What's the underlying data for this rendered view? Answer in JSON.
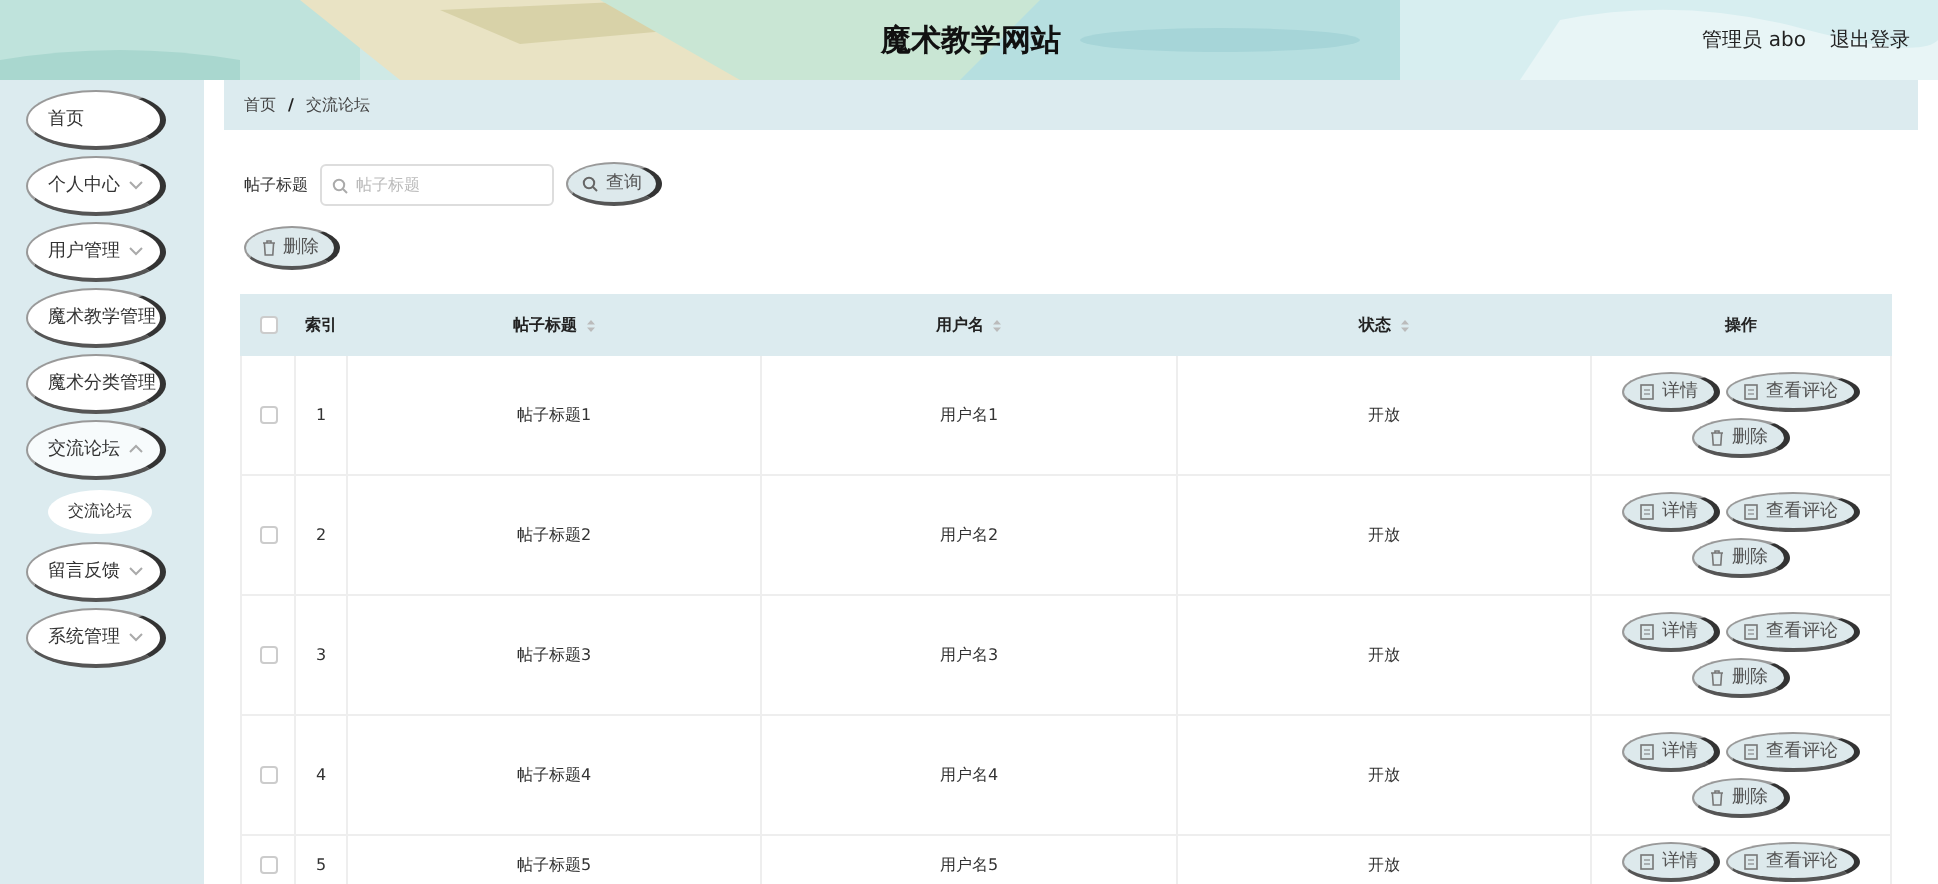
{
  "header": {
    "title": "魔术教学网站",
    "user": "管理员 abo",
    "logout": "退出登录"
  },
  "sidebar": {
    "items": [
      {
        "label": "首页",
        "has_children": false
      },
      {
        "label": "个人中心",
        "has_children": true,
        "expanded": false
      },
      {
        "label": "用户管理",
        "has_children": true,
        "expanded": false
      },
      {
        "label": "魔术教学管理",
        "has_children": false
      },
      {
        "label": "魔术分类管理",
        "has_children": false
      },
      {
        "label": "交流论坛",
        "has_children": true,
        "expanded": true,
        "children": [
          {
            "label": "交流论坛"
          }
        ]
      },
      {
        "label": "留言反馈",
        "has_children": true,
        "expanded": false
      },
      {
        "label": "系统管理",
        "has_children": true,
        "expanded": false
      }
    ]
  },
  "breadcrumb": [
    "首页",
    "交流论坛"
  ],
  "breadcrumb_separator": "/",
  "search": {
    "label": "帖子标题",
    "placeholder": "帖子标题",
    "button": "查询"
  },
  "delete_button": "删除",
  "table": {
    "select_all_checked": false,
    "columns": [
      {
        "label": "索引",
        "sortable": false
      },
      {
        "label": "帖子标题",
        "sortable": true
      },
      {
        "label": "用户名",
        "sortable": true
      },
      {
        "label": "状态",
        "sortable": true
      },
      {
        "label": "操作",
        "sortable": false
      }
    ],
    "rows": [
      {
        "checked": false,
        "index": "1",
        "title": "帖子标题1",
        "user": "用户名1",
        "status": "开放",
        "actions": [
          "详情",
          "查看评论",
          "删除"
        ]
      },
      {
        "checked": false,
        "index": "2",
        "title": "帖子标题2",
        "user": "用户名2",
        "status": "开放",
        "actions": [
          "详情",
          "查看评论",
          "删除"
        ]
      },
      {
        "checked": false,
        "index": "3",
        "title": "帖子标题3",
        "user": "用户名3",
        "status": "开放",
        "actions": [
          "详情",
          "查看评论",
          "删除"
        ]
      },
      {
        "checked": false,
        "index": "4",
        "title": "帖子标题4",
        "user": "用户名4",
        "status": "开放",
        "actions": [
          "详情",
          "查看评论",
          "删除"
        ]
      },
      {
        "checked": false,
        "index": "5",
        "title": "帖子标题5",
        "user": "用户名5",
        "status": "开放",
        "actions": [
          "详情",
          "查看评论"
        ]
      }
    ]
  }
}
